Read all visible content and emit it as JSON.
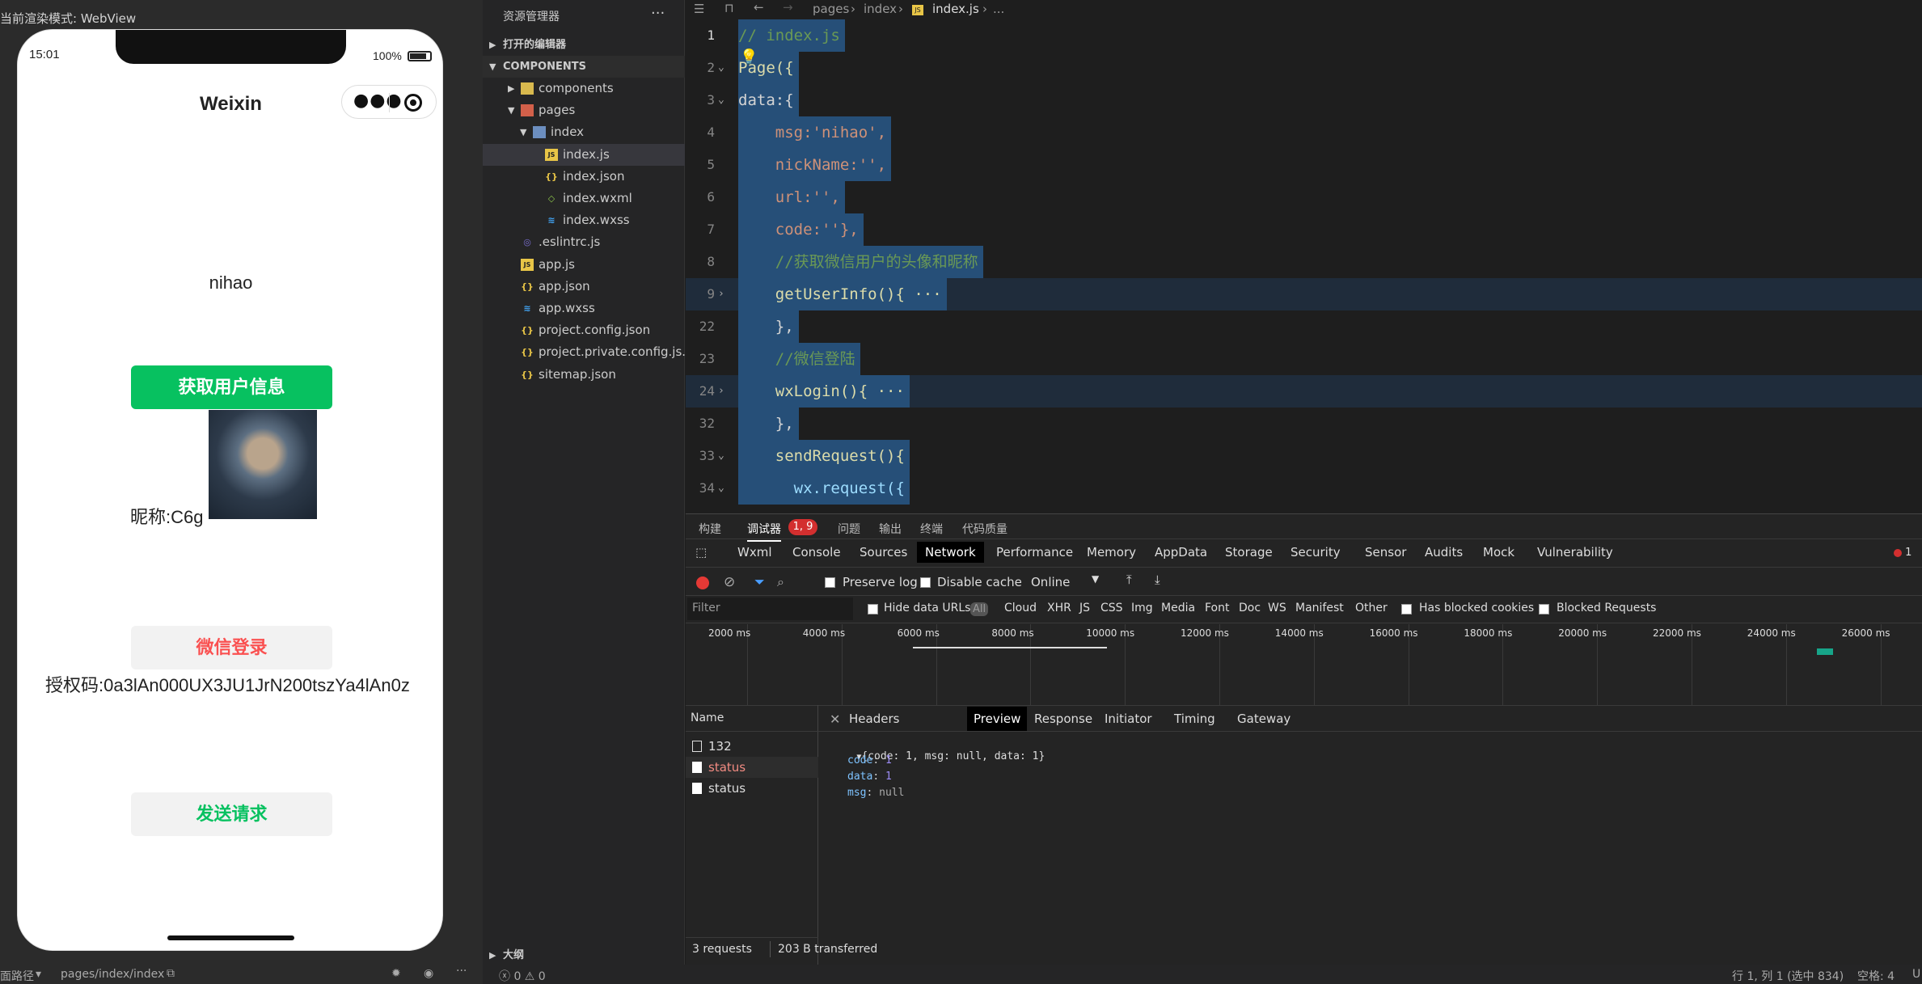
{
  "simulator": {
    "render_mode": "当前渲染模式: WebView",
    "status_time": "15:01",
    "battery": "100%",
    "nav_title": "Weixin",
    "msg": "nihao",
    "get_user_info_button": "获取用户信息",
    "nickname": "昵称:C6g",
    "login_button": "微信登录",
    "auth_code": "授权码:0a3lAn000UX3JU1JrN200tszYa4lAn0z",
    "send_request_button": "发送请求",
    "footer_path_label": "面路径",
    "footer_path": "pages/index/index"
  },
  "explorer": {
    "title": "资源管理器",
    "more": "···",
    "open_editors": "打开的编辑器",
    "project": "COMPONENTS",
    "items": [
      {
        "label": "components",
        "type": "folder-yellow",
        "level": 1
      },
      {
        "label": "pages",
        "type": "folder-red",
        "level": 1
      },
      {
        "label": "index",
        "type": "folder-blue",
        "level": 2
      },
      {
        "label": "index.js",
        "type": "js",
        "level": 3
      },
      {
        "label": "index.json",
        "type": "json",
        "level": 3
      },
      {
        "label": "index.wxml",
        "type": "wxml",
        "level": 3
      },
      {
        "label": "index.wxss",
        "type": "wxss",
        "level": 3
      },
      {
        "label": ".eslintrc.js",
        "type": "eslint",
        "level": 1
      },
      {
        "label": "app.js",
        "type": "js",
        "level": 1
      },
      {
        "label": "app.json",
        "type": "json",
        "level": 1
      },
      {
        "label": "app.wxss",
        "type": "wxss",
        "level": 1
      },
      {
        "label": "project.config.json",
        "type": "json",
        "level": 1
      },
      {
        "label": "project.private.config.js...",
        "type": "json",
        "level": 1
      },
      {
        "label": "sitemap.json",
        "type": "json",
        "level": 1
      }
    ],
    "outline": "大纲"
  },
  "editor": {
    "breadcrumb": [
      "pages",
      "index",
      "index.js",
      "..."
    ],
    "lines": [
      {
        "n": "1",
        "text": "// index.js"
      },
      {
        "n": "2",
        "text": "Page({"
      },
      {
        "n": "3",
        "text": "data:{"
      },
      {
        "n": "4",
        "text": "    msg:'nihao',"
      },
      {
        "n": "5",
        "text": "    nickName:'',"
      },
      {
        "n": "6",
        "text": "    url:'',"
      },
      {
        "n": "7",
        "text": "    code:''},"
      },
      {
        "n": "8",
        "text": "    //获取微信用户的头像和昵称"
      },
      {
        "n": "9",
        "text": "    getUserInfo(){ ···"
      },
      {
        "n": "22",
        "text": "    },"
      },
      {
        "n": "23",
        "text": "    //微信登陆"
      },
      {
        "n": "24",
        "text": "    wxLogin(){ ···"
      },
      {
        "n": "32",
        "text": "    },"
      },
      {
        "n": "33",
        "text": "    sendRequest(){"
      },
      {
        "n": "34",
        "text": "      wx.request({"
      }
    ]
  },
  "devtools": {
    "top_tabs": [
      "构建",
      "调试器",
      "问题",
      "输出",
      "终端",
      "代码质量"
    ],
    "badge": "1, 9",
    "main_tabs": [
      "Wxml",
      "Console",
      "Sources",
      "Network",
      "Performance",
      "Memory",
      "AppData",
      "Storage",
      "Security",
      "Sensor",
      "Audits",
      "Mock",
      "Vulnerability"
    ],
    "error_count": "1",
    "toolbar": {
      "preserve_log": "Preserve log",
      "disable_cache": "Disable cache",
      "throttle": "Online"
    },
    "filter": {
      "placeholder": "Filter",
      "hide_data_urls": "Hide data URLs",
      "types": [
        "All",
        "Cloud",
        "XHR",
        "JS",
        "CSS",
        "Img",
        "Media",
        "Font",
        "Doc",
        "WS",
        "Manifest",
        "Other"
      ],
      "has_blocked_cookies": "Has blocked cookies",
      "blocked_requests": "Blocked Requests"
    },
    "timeline_ticks": [
      "2000 ms",
      "4000 ms",
      "6000 ms",
      "8000 ms",
      "10000 ms",
      "12000 ms",
      "14000 ms",
      "16000 ms",
      "18000 ms",
      "20000 ms",
      "22000 ms",
      "24000 ms",
      "26000 ms"
    ],
    "name_header": "Name",
    "requests": [
      {
        "name": "132",
        "error": false
      },
      {
        "name": "status",
        "error": true
      },
      {
        "name": "status",
        "error": false
      }
    ],
    "detail_tabs": [
      "Headers",
      "Preview",
      "Response",
      "Initiator",
      "Timing",
      "Gateway"
    ],
    "preview": {
      "summary": "{code: 1, msg: null, data: 1}",
      "code_key": "code",
      "code_val": "1",
      "data_key": "data",
      "data_val": "1",
      "msg_key": "msg",
      "msg_val": "null"
    },
    "summary_requests": "3 requests",
    "summary_transferred": "203 B transferred"
  },
  "statusbar": {
    "problems": "ⓧ 0 ⚠ 0",
    "position": "行 1, 列 1 (选中 834)",
    "spaces": "空格: 4",
    "encoding": "U"
  }
}
